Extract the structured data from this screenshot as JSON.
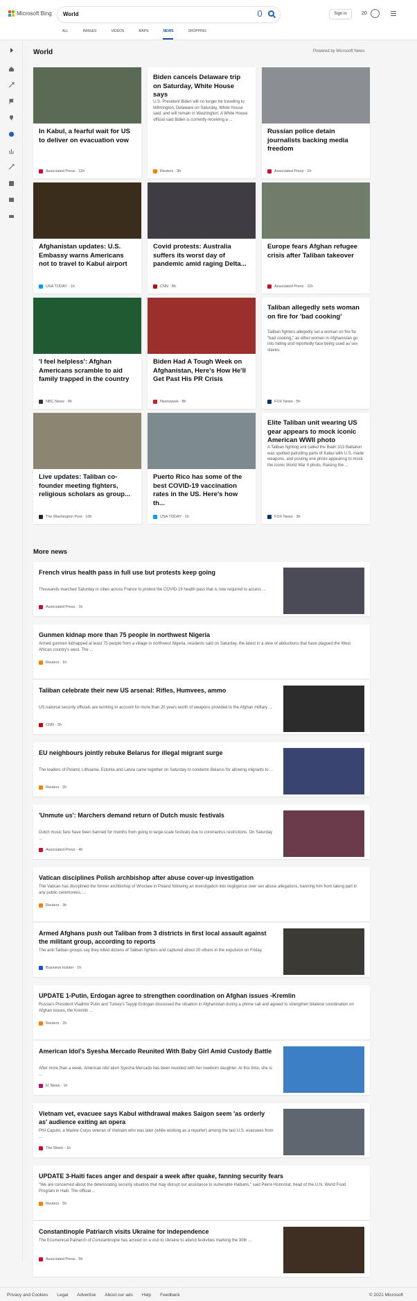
{
  "header": {
    "brand": "Microsoft Bing",
    "query": "World",
    "signin": "Sign in",
    "points": "20",
    "tabs": [
      "ALL",
      "IMAGES",
      "VIDEOS",
      "MAPS",
      "NEWS",
      "SHOPPING"
    ],
    "active_tab": "NEWS"
  },
  "section": {
    "title": "World",
    "powered": "Powered by Microsoft News"
  },
  "cards": [
    {
      "title": "In Kabul, a fearful wait for US to deliver on evacuation vow",
      "source": "Associated Press",
      "age": "11h",
      "img": "#5a6a55",
      "has_img": true
    },
    {
      "title": "Biden cancels Delaware trip on Saturday, White House says",
      "desc": "U.S. President Biden will no longer be traveling to Wilmington, Delaware on Saturday, White House said, and will remain in Washington. A White House official said Biden is currently receiving a ...",
      "source": "Reuters",
      "age": "3h",
      "has_img": false
    },
    {
      "title": "Russian police detain journalists backing media freedom",
      "source": "Associated Press",
      "age": "1h",
      "img": "#8b8f94",
      "has_img": true
    },
    {
      "title": "Afghanistan updates: U.S. Embassy warns Americans not to travel to Kabul airport",
      "source": "USA TODAY",
      "age": "1h",
      "img": "#3a2d1c",
      "has_img": true
    },
    {
      "title": "Covid protests: Australia suffers its worst day of pandemic amid raging Delta...",
      "source": "CNN",
      "age": "8h",
      "img": "#3f3d43",
      "has_img": true
    },
    {
      "title": "Europe fears Afghan refugee crisis after Taliban takeover",
      "source": "Associated Press",
      "age": "11h",
      "img": "#6f7d6a",
      "has_img": true
    },
    {
      "title": "'I feel helpless': Afghan Americans scramble to aid family trapped in the country",
      "source": "NBC News",
      "age": "9h",
      "img": "#1f5a33",
      "has_img": true
    },
    {
      "title": "Biden Had A Tough Week on Afghanistan, Here's How He'll Get Past His PR Crisis",
      "source": "Newsweek",
      "age": "8h",
      "img": "#9b2f2c",
      "has_img": true
    },
    {
      "title": "Taliban allegedly sets woman on fire for 'bad cooking'",
      "desc": "Taliban fighters allegedly set a woman on fire for \"bad cooking,\" as other women in Afghanistan go into hiding and reportedly face being used as sex slaves.",
      "source": "FOX News",
      "age": "5h",
      "has_img": false
    },
    {
      "title": "Live updates: Taliban co-founder meeting fighters, religious scholars as group...",
      "source": "The Washington Post",
      "age": "10h",
      "img": "#8c8572",
      "has_img": true
    },
    {
      "title": "Puerto Rico has some of the best COVID-19 vaccination rates in the US. Here's how th...",
      "source": "USA TODAY",
      "age": "1h",
      "img": "#7d8a8e",
      "has_img": true
    },
    {
      "title": "Elite Taliban unit wearing US gear appears to mock iconic American WWII photo",
      "desc": "A Taliban fighting unit called the Badri 313 Battalion was spotted patrolling parts of Kabul with U.S. made weapons, and posting one photo appearing to mock the iconic World War II photo, Raising the ...",
      "source": "FOX News",
      "age": "3h",
      "has_img": false
    }
  ],
  "more_news": {
    "title": "More news",
    "items": [
      {
        "title": "French virus health pass in full use but protests keep going",
        "desc": "Thousands marched Saturday in cities across France to protest the COVID-19 health pass that is now required to access ...",
        "source": "Associated Press",
        "age": "1h",
        "img": "#4b4a57",
        "has_img": true
      },
      {
        "title": "Gunmen kidnap more than 75 people in northwest Nigeria",
        "desc": "Armed gunmen kidnapped at least 75 people from a village in northwest Nigeria, residents said on Saturday, the latest in a slew of abductions that have plagued the West African country's west. The ...",
        "source": "Reuters",
        "age": "1h",
        "has_img": false
      },
      {
        "title": "Taliban celebrate their new US arsenal: Rifles, Humvees, ammo",
        "desc": "US national security officials are working to account for more than 20 years worth of weapons provided to the Afghan military ...",
        "source": "CNN",
        "age": "3h",
        "img": "#2c2c2c",
        "has_img": true
      },
      {
        "title": "EU neighbours jointly rebuke Belarus for illegal migrant surge",
        "desc": "The leaders of Poland, Lithuania, Estonia and Latvia came together on Saturday to condemn Belarus for allowing migrants to ...",
        "source": "Reuters",
        "age": "2h",
        "img": "#3a4470",
        "has_img": true
      },
      {
        "title": "'Unmute us': Marchers demand return of Dutch music festivals",
        "desc": "Dutch music fans have been banned for months from going to large-scale festivals due to coronavirus restrictions. On Saturday ...",
        "source": "Associated Press",
        "age": "4h",
        "img": "#6b3b4c",
        "has_img": true
      },
      {
        "title": "Vatican disciplines Polish archbishop after abuse cover-up investigation",
        "desc": "The Vatican has disciplined the former archbishop of Wroclaw in Poland following an investigation into negligence over sex abuse allegations, banning him from taking part in any public ceremonies, ...",
        "source": "Reuters",
        "age": "3h",
        "has_img": false
      },
      {
        "title": "Armed Afghans push out Taliban from 3 districts in first local assault against the militant group, according to reports",
        "desc": "The anti-Taliban groups say they killed dozens of Taliban fighters and captured about 20 others in the expulsion on Friday.",
        "source": "Business Insider",
        "age": "1h",
        "img": "#3b3a34",
        "has_img": true
      },
      {
        "title": "UPDATE 1-Putin, Erdogan agree to strengthen coordination on Afghan issues -Kremlin",
        "desc": "Russia's President Vladimir Putin and Turkey's Tayyip Erdogan discussed the situation in Afghanistan during a phone call and agreed to strengthen bilateral coordination on Afghan issues, the Kremlin ...",
        "source": "Reuters",
        "age": "2h",
        "has_img": false
      },
      {
        "title": "American Idol's Syesha Mercado Reunited With Baby Girl Amid Custody Battle",
        "desc": "After more than a week, American Idol alum Syesha Mercado has been reunited with her newborn daughter. At this time, she is ...",
        "source": "E! News",
        "age": "1h",
        "img": "#3d7fc4",
        "has_img": true
      },
      {
        "title": "Vietnam vet, evacuee says Kabul withdrawal makes Saigon seem 'as orderly as' audience exiting an opera",
        "desc": "Phil Caputo, a Marine Corps veteran of Vietnam who was later (while working as a reporter) among the last U.S. evacuees from ...",
        "source": "The Week",
        "age": "1h",
        "img": "#5f6670",
        "has_img": true
      },
      {
        "title": "UPDATE 3-Haiti faces anger and despair a week after quake, fanning security fears",
        "desc": "\"We are concerned about the deteriorating security situation that may disrupt our assistance to vulnerable Haitians,\" said Pierre Honnorat, head of the U.N. World Food Program in Haiti. The official ...",
        "source": "Reuters",
        "age": "5h",
        "has_img": false
      },
      {
        "title": "Constantinople Patriarch visits Ukraine for independence",
        "desc": "The Ecumenical Patriarch of Constantinople has arrived on a visit to Ukraine to attend festivities marking the 30th ...",
        "source": "Associated Press",
        "age": "5h",
        "img": "#3e2f22",
        "has_img": true
      }
    ]
  },
  "source_colors": {
    "Associated Press": "#c8102e",
    "Reuters": "#ff8000",
    "USA TODAY": "#009bff",
    "CNN": "#cc0000",
    "NBC News": "#333333",
    "Newsweek": "#d71920",
    "FOX News": "#003366",
    "The Washington Post": "#222222",
    "Business Insider": "#1f4cdd",
    "E! News": "#b1126a",
    "The Week": "#c8102e"
  },
  "footer": {
    "links": [
      "Privacy and Cookies",
      "Legal",
      "Advertise",
      "About our ads",
      "Help",
      "Feedback"
    ],
    "copyright": "© 2021 Microsoft"
  }
}
